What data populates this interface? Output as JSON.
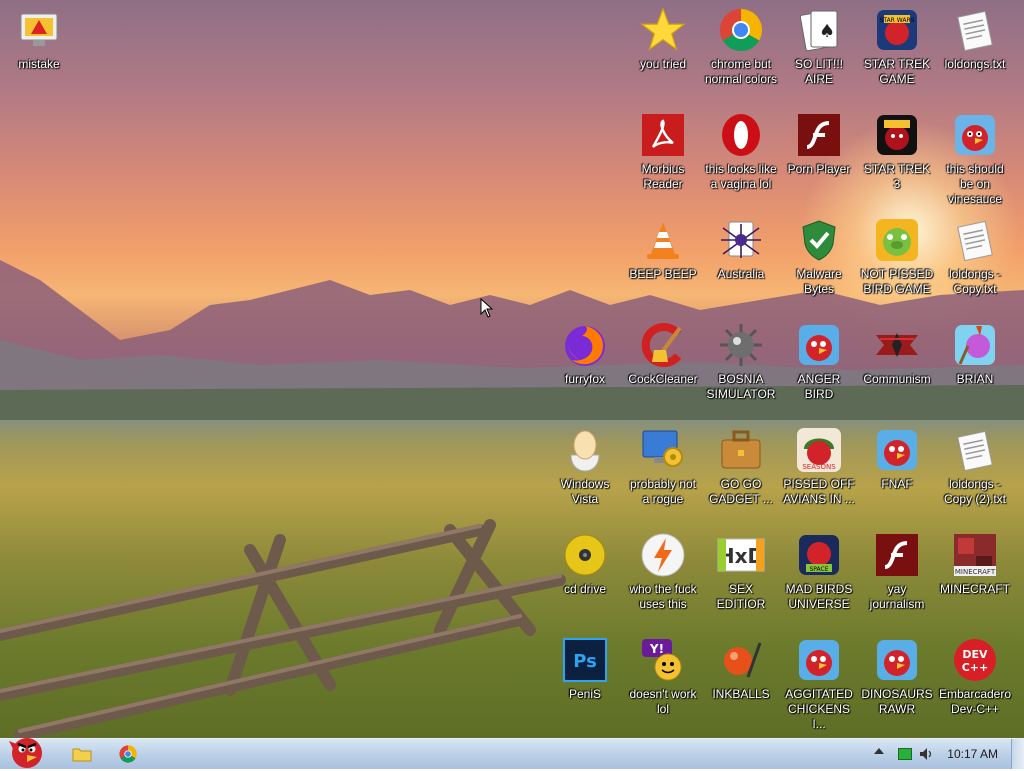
{
  "desktop": {
    "icons": [
      {
        "label": "mistake",
        "icon": "monitor-warning-icon"
      },
      {
        "label": "you tried",
        "icon": "star-icon"
      },
      {
        "label": "chrome but normal colors",
        "icon": "chrome-icon"
      },
      {
        "label": "SO LIT!!! AIRE",
        "icon": "solitaire-cards-icon"
      },
      {
        "label": "STAR TREK GAME",
        "icon": "angry-birds-star-wars-icon"
      },
      {
        "label": "loldongs.txt",
        "icon": "text-file-icon"
      },
      {
        "label": "Morbius Reader",
        "icon": "pdf-reader-icon"
      },
      {
        "label": "this looks like a vagina lol",
        "icon": "opera-icon"
      },
      {
        "label": "Porn Player",
        "icon": "flash-player-icon"
      },
      {
        "label": "STAR TREK 3",
        "icon": "angry-birds-star-wars-2-icon"
      },
      {
        "label": "this should be on vinesauce",
        "icon": "angry-bird-icon"
      },
      {
        "label": "BEEP BEEP",
        "icon": "vlc-cone-icon"
      },
      {
        "label": "Australia",
        "icon": "spider-solitaire-icon"
      },
      {
        "label": "Malware Bytes",
        "icon": "shield-check-icon"
      },
      {
        "label": "NOT PISSED BIRD GAME",
        "icon": "bad-piggies-icon"
      },
      {
        "label": "loldongs - Copy.txt",
        "icon": "text-file-icon"
      },
      {
        "label": "furryfox",
        "icon": "firefox-icon"
      },
      {
        "label": "CockCleaner",
        "icon": "ccleaner-icon"
      },
      {
        "label": "BOSNIA SIMULATOR",
        "icon": "minesweeper-mine-icon"
      },
      {
        "label": "ANGER BIRD",
        "icon": "angry-bird-icon"
      },
      {
        "label": "Communism",
        "icon": "communism-emblem-icon"
      },
      {
        "label": "BRIAN",
        "icon": "angry-birds-rio-icon"
      },
      {
        "label": "Windows Vista",
        "icon": "egg-icon"
      },
      {
        "label": "probably not a rogue",
        "icon": "monitor-gears-icon"
      },
      {
        "label": "GO GO GADGET ...",
        "icon": "briefcase-icon"
      },
      {
        "label": "PISSED OFF AVIANS IN ...",
        "icon": "angry-birds-seasons-icon"
      },
      {
        "label": "FNAF",
        "icon": "angry-bird-icon"
      },
      {
        "label": "loldongs - Copy (2).txt",
        "icon": "text-file-icon"
      },
      {
        "label": "cd drive",
        "icon": "cd-drive-icon"
      },
      {
        "label": "who the fuck uses this",
        "icon": "winamp-bolt-icon"
      },
      {
        "label": "SEX EDITIOR",
        "icon": "hxd-editor-icon"
      },
      {
        "label": "MAD BIRDS UNIVERSE",
        "icon": "angry-birds-space-icon"
      },
      {
        "label": "yay journalism",
        "icon": "flash-player-icon"
      },
      {
        "label": "MINECRAFT",
        "icon": "minecraft-icon"
      },
      {
        "label": "PeniS",
        "icon": "photoshop-icon"
      },
      {
        "label": "doesn't work lol",
        "icon": "yahoo-messenger-icon"
      },
      {
        "label": "INKBALLS",
        "icon": "inkball-icon"
      },
      {
        "label": "AGGITATED CHICKENS I...",
        "icon": "angry-bird-icon"
      },
      {
        "label": "DINOSAURS RAWR",
        "icon": "angry-bird-icon"
      },
      {
        "label": "Embarcadero Dev-C++",
        "icon": "dev-cpp-icon"
      }
    ]
  },
  "taskbar": {
    "start_icon": "angry-bird-start-icon",
    "pinned": [
      {
        "icon": "folder-icon"
      },
      {
        "icon": "chrome-icon"
      }
    ],
    "tray_icons": [
      "tray-expand-icon",
      "battery-icon",
      "speaker-icon"
    ],
    "clock": "10:17 AM"
  },
  "colors": {
    "taskbar": "#bcd1e8",
    "angry_red": "#d2232a",
    "text_white": "#ffffff"
  }
}
